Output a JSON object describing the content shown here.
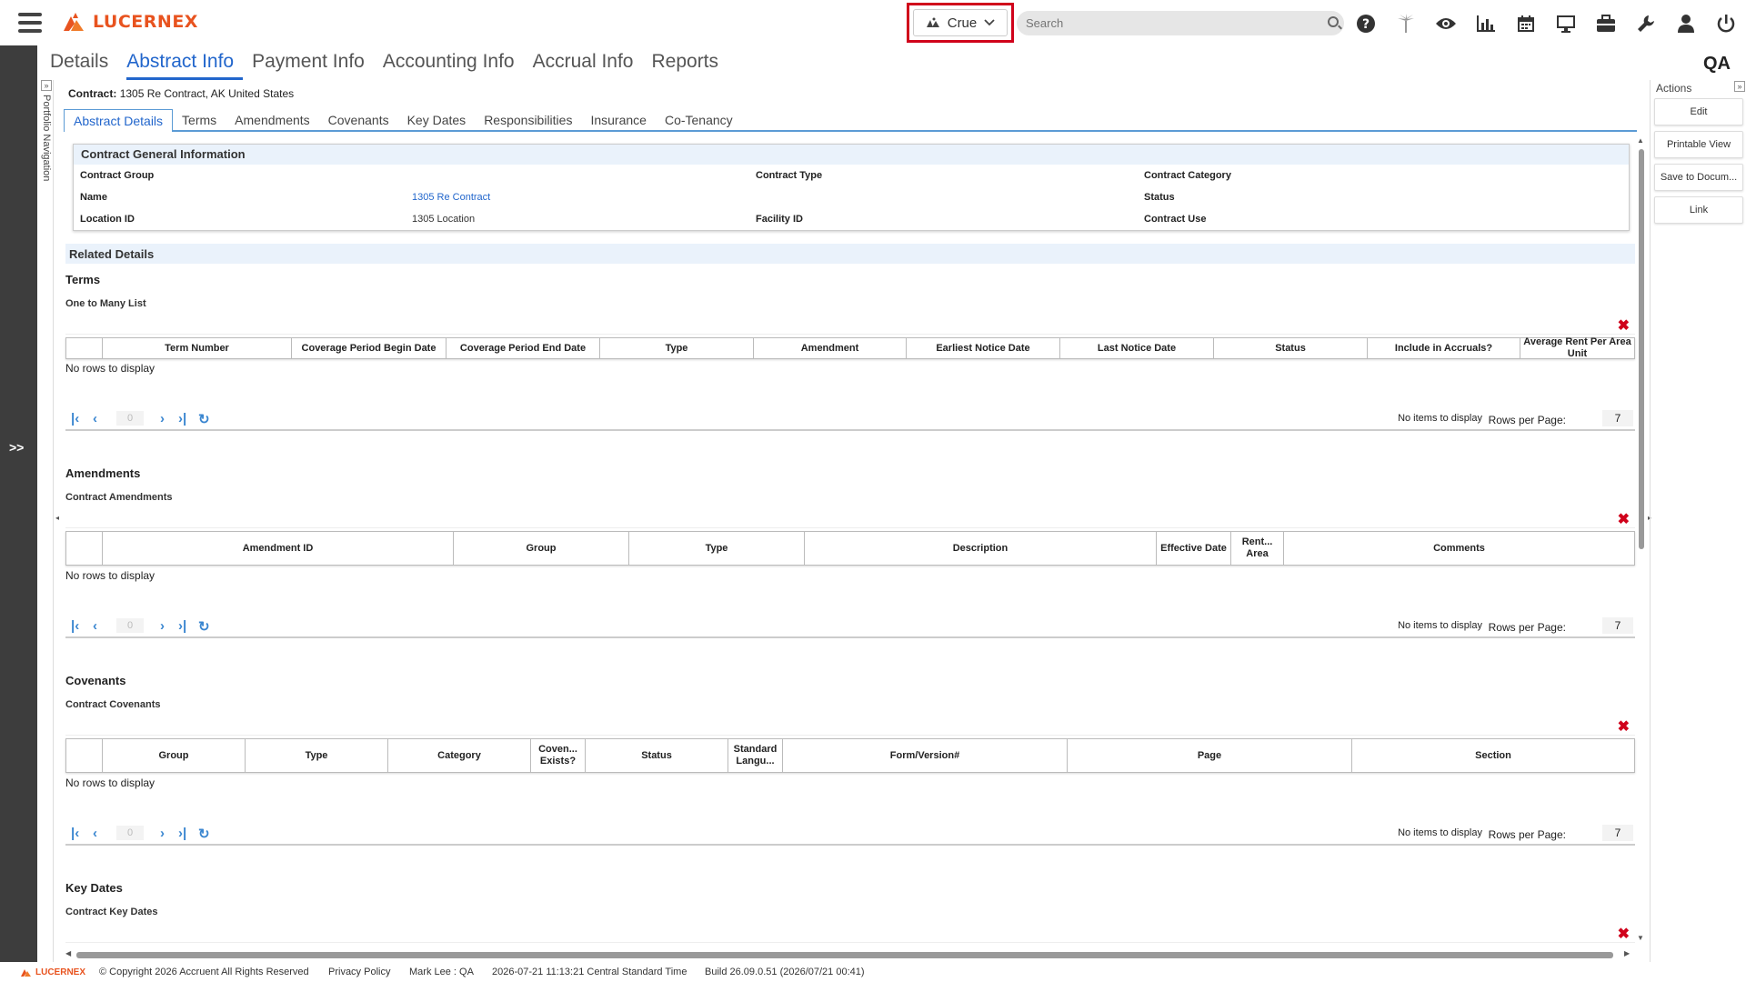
{
  "header": {
    "logo_text": "LUCERNEX",
    "tenant": "Crue",
    "search_placeholder": "Search",
    "icons": [
      "help-icon",
      "palm-tree-icon",
      "eye-icon",
      "bar-chart-icon",
      "calendar-icon",
      "monitor-icon",
      "briefcase-icon",
      "wrench-icon",
      "user-icon",
      "power-icon"
    ]
  },
  "main_tabs": [
    "Details",
    "Abstract Info",
    "Payment Info",
    "Accounting Info",
    "Accrual Info",
    "Reports"
  ],
  "active_main_tab": "Abstract Info",
  "environment": "QA",
  "rail": {
    "expand_label": ">>"
  },
  "portfolio_nav": {
    "label": "Portfolio Navigation"
  },
  "contract": {
    "label": "Contract:",
    "value": "1305 Re Contract, AK United States"
  },
  "sub_tabs": [
    "Abstract Details",
    "Terms",
    "Amendments",
    "Covenants",
    "Key Dates",
    "Responsibilities",
    "Insurance",
    "Co-Tenancy"
  ],
  "general": {
    "title": "Contract General Information",
    "contract_group_label": "Contract Group",
    "contract_type_label": "Contract Type",
    "contract_category_label": "Contract Category",
    "name_label": "Name",
    "name_value": "1305 Re Contract",
    "status_label": "Status",
    "location_id_label": "Location ID",
    "location_id_value": "1305 Location",
    "facility_id_label": "Facility ID",
    "contract_use_label": "Contract Use"
  },
  "related": {
    "title": "Related Details",
    "terms": {
      "title": "Terms",
      "subtitle": "One to Many List",
      "columns": [
        "",
        "Term Number",
        "Coverage Period Begin Date",
        "Coverage Period End Date",
        "Type",
        "Amendment",
        "Earliest Notice Date",
        "Last Notice Date",
        "Status",
        "Include in Accruals?",
        "Average Rent Per Area Unit"
      ]
    },
    "amendments": {
      "title": "Amendments",
      "subtitle": "Contract Amendments",
      "columns": [
        "",
        "Amendment ID",
        "Group",
        "Type",
        "Description",
        "Effective Date",
        "Rent... Area",
        "Comments"
      ]
    },
    "covenants": {
      "title": "Covenants",
      "subtitle": "Contract Covenants",
      "columns": [
        "",
        "Group",
        "Type",
        "Category",
        "Coven... Exists?",
        "Status",
        "Standard Langu...",
        "Form/Version#",
        "Page",
        "Section"
      ]
    },
    "key_dates": {
      "title": "Key Dates",
      "subtitle": "Contract Key Dates"
    },
    "no_rows": "No rows to display",
    "pager": {
      "page": "0",
      "info": "No items to display",
      "rpp_label": "Rows per Page:",
      "rpp_value": "7"
    }
  },
  "actions": {
    "title": "Actions",
    "buttons": [
      "Edit",
      "Printable View",
      "Save to Docum...",
      "Link"
    ]
  },
  "footer": {
    "logo": "LUCERNEX",
    "copyright": "© Copyright 2026 Accruent All Rights Reserved",
    "privacy": "Privacy Policy",
    "user": "Mark Lee : QA",
    "time": "2026-07-21 11:13:21 Central Standard Time",
    "build": "Build 26.09.0.51 (2026/07/21 00:41)"
  }
}
